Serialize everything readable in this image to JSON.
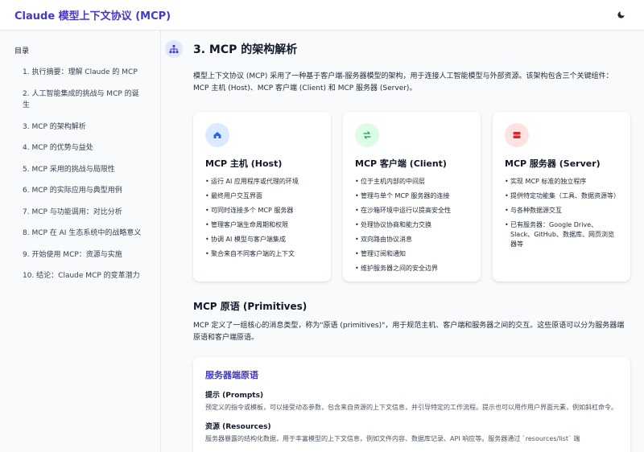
{
  "header": {
    "app_title": "Claude 模型上下文协议 (MCP)",
    "theme_icon": "moon-icon"
  },
  "sidebar": {
    "title": "目录",
    "items": [
      {
        "label": "1. 执行摘要：理解 Claude 的 MCP"
      },
      {
        "label": "2. 人工智能集成的挑战与 MCP 的诞生"
      },
      {
        "label": "3. MCP 的架构解析"
      },
      {
        "label": "4. MCP 的优势与益处"
      },
      {
        "label": "5. MCP 采用的挑战与局限性"
      },
      {
        "label": "6. MCP 的实际应用与典型用例"
      },
      {
        "label": "7. MCP 与功能调用：对比分析"
      },
      {
        "label": "8. MCP 在 AI 生态系统中的战略意义"
      },
      {
        "label": "9. 开始使用 MCP：资源与实施"
      },
      {
        "label": "10. 结论：Claude MCP 的变革潜力"
      }
    ]
  },
  "main": {
    "section_icon": "sitemap-icon",
    "section_title": "3. MCP 的架构解析",
    "intro": "模型上下文协议 (MCP) 采用了一种基于客户端-服务器模型的架构，用于连接人工智能模型与外部资源。该架构包含三个关键组件：MCP 主机 (Host)、MCP 客户端 (Client) 和 MCP 服务器 (Server)。",
    "cards": [
      {
        "icon": "laptop-house-icon",
        "icon_bg": "#dbeafe",
        "icon_color": "#2563eb",
        "title": "MCP 主机 (Host)",
        "items": [
          "运行 AI 应用程序或代理的环境",
          "最终用户交互界面",
          "可同时连接多个 MCP 服务器",
          "管理客户端生命周期和权限",
          "协调 AI 模型与客户端集成",
          "聚合来自不同客户端的上下文"
        ]
      },
      {
        "icon": "exchange-icon",
        "icon_bg": "#dcfce7",
        "icon_color": "#16a34a",
        "title": "MCP 客户端 (Client)",
        "items": [
          "位于主机内部的中间层",
          "管理与单个 MCP 服务器的连接",
          "在沙箱环境中运行以提高安全性",
          "处理协议协商和能力交换",
          "双向路由协议消息",
          "管理订阅和通知",
          "维护服务器之间的安全边界"
        ]
      },
      {
        "icon": "server-icon",
        "icon_bg": "#fee2e2",
        "icon_color": "#dc2626",
        "title": "MCP 服务器 (Server)",
        "items": [
          "实现 MCP 标准的独立程序",
          "提供特定功能集（工具、数据资源等）",
          "与各种数据源交互",
          "已有服务器：Google Drive、Slack、GitHub、数据库、网页浏览器等"
        ]
      }
    ],
    "primitives_heading": "MCP 原语 (Primitives)",
    "primitives_desc": "MCP 定义了一组核心的消息类型，称为\"原语 (primitives)\"，用于规范主机、客户端和服务器之间的交互。这些原语可以分为服务器端原语和客户端原语。",
    "server_panel": {
      "title": "服务器端原语",
      "items": [
        {
          "title": "提示 (Prompts)",
          "desc": "预定义的指令或模板，可以接受动态参数，包含来自资源的上下文信息，并引导特定的工作流程。提示也可以用作用户界面元素，例如斜杠命令。"
        },
        {
          "title": "资源 (Resources)",
          "desc": "服务器暴露的结构化数据，用于丰富模型的上下文信息，例如文件内容、数据库记录、API 响应等。服务器通过 `resources/list` 端"
        }
      ]
    }
  }
}
